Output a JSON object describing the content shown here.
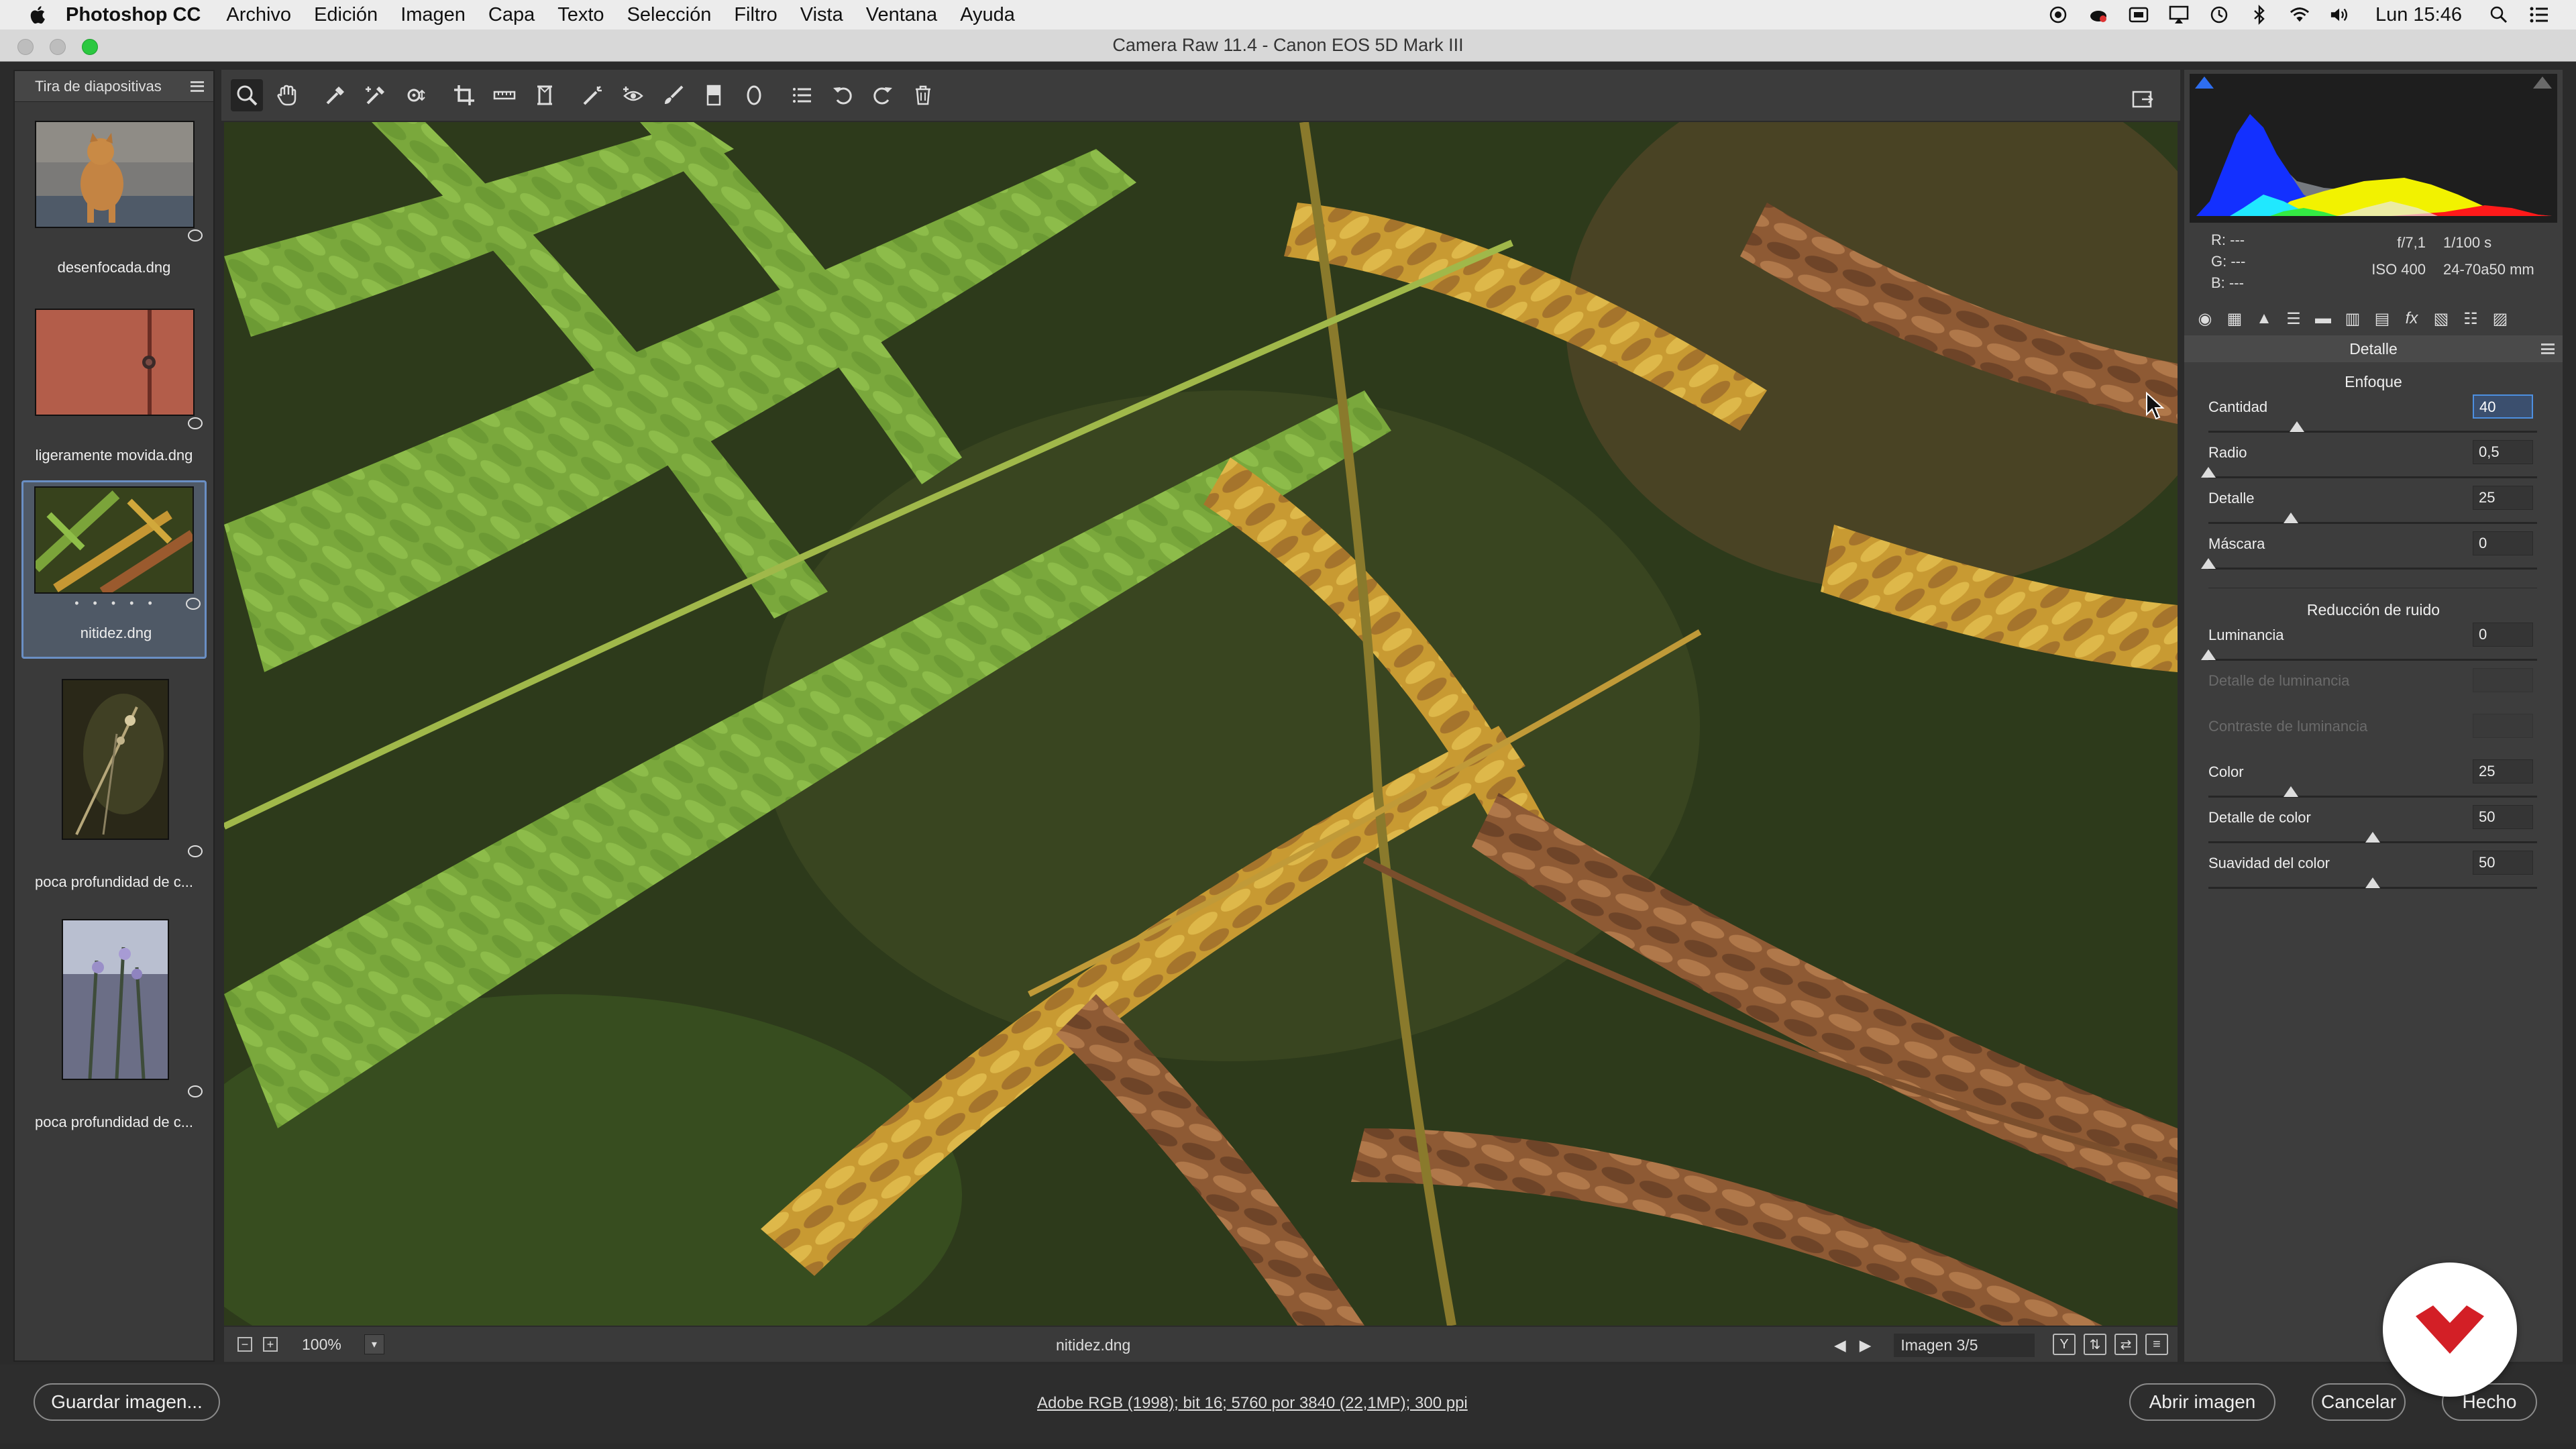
{
  "menubar": {
    "app_name": "Photoshop CC",
    "items": [
      "Archivo",
      "Edición",
      "Imagen",
      "Capa",
      "Texto",
      "Selección",
      "Filtro",
      "Vista",
      "Ventana",
      "Ayuda"
    ],
    "clock": "Lun 15:46"
  },
  "window": {
    "title": "Camera Raw 11.4 -  Canon EOS 5D Mark III"
  },
  "filmstrip": {
    "title": "Tira de diapositivas",
    "items": [
      {
        "label": "desenfocada.dng"
      },
      {
        "label": "ligeramente movida.dng"
      },
      {
        "label": "nitidez.dng",
        "selected": true,
        "rating_dots": "• • • • •"
      },
      {
        "label": "poca profundidad de c..."
      },
      {
        "label": "poca profundidad de c..."
      }
    ]
  },
  "toolbar": {
    "tools": [
      "zoom-tool",
      "hand-tool",
      "white-balance-tool",
      "color-sampler-tool",
      "targeted-adjustment-tool",
      "crop-tool",
      "straighten-tool",
      "transform-tool",
      "spot-removal-tool",
      "red-eye-tool",
      "adjustment-brush-tool",
      "graduated-filter-tool",
      "radial-filter-tool",
      "preferences-tool",
      "rotate-left-tool",
      "rotate-right-tool",
      "trash-tool"
    ],
    "active_tool": "zoom-tool"
  },
  "preview": {
    "filename": "nitidez.dng",
    "zoom": "100%",
    "image_counter": "Imagen 3/5"
  },
  "info": {
    "r_label": "R:",
    "r_value": "---",
    "g_label": "G:",
    "g_value": "---",
    "b_label": "B:",
    "b_value": "---",
    "aperture": "f/7,1",
    "shutter": "1/100 s",
    "iso": "ISO 400",
    "lens": "24-70a50 mm"
  },
  "detail_panel": {
    "title": "Detalle",
    "sharpening": {
      "title": "Enfoque",
      "sliders": [
        {
          "label": "Cantidad",
          "value": "40",
          "level": 0.27,
          "focused": true
        },
        {
          "label": "Radio",
          "value": "0,5",
          "level": 0.0
        },
        {
          "label": "Detalle",
          "value": "25",
          "level": 0.25
        },
        {
          "label": "Máscara",
          "value": "0",
          "level": 0.0
        }
      ]
    },
    "noise": {
      "title": "Reducción de ruido",
      "sliders": [
        {
          "label": "Luminancia",
          "value": "0",
          "level": 0.0
        },
        {
          "label": "Detalle de luminancia",
          "value": "",
          "disabled": true
        },
        {
          "label": "Contraste de luminancia",
          "value": "",
          "disabled": true
        },
        {
          "label": "Color",
          "value": "25",
          "level": 0.25
        },
        {
          "label": "Detalle de color",
          "value": "50",
          "level": 0.5
        },
        {
          "label": "Suavidad del color",
          "value": "50",
          "level": 0.5
        }
      ]
    }
  },
  "footer": {
    "save_label": "Guardar imagen...",
    "workflow_text": "Adobe RGB (1998); bit 16; 5760 por 3840 (22,1MP); 300 ppi",
    "open_label": "Abrir imagen",
    "cancel_label": "Cancelar",
    "done_label": "Hecho"
  },
  "colors": {
    "accent": "#4d8fe0",
    "panel": "#3d3d3d",
    "logo_red": "#d31f26"
  }
}
